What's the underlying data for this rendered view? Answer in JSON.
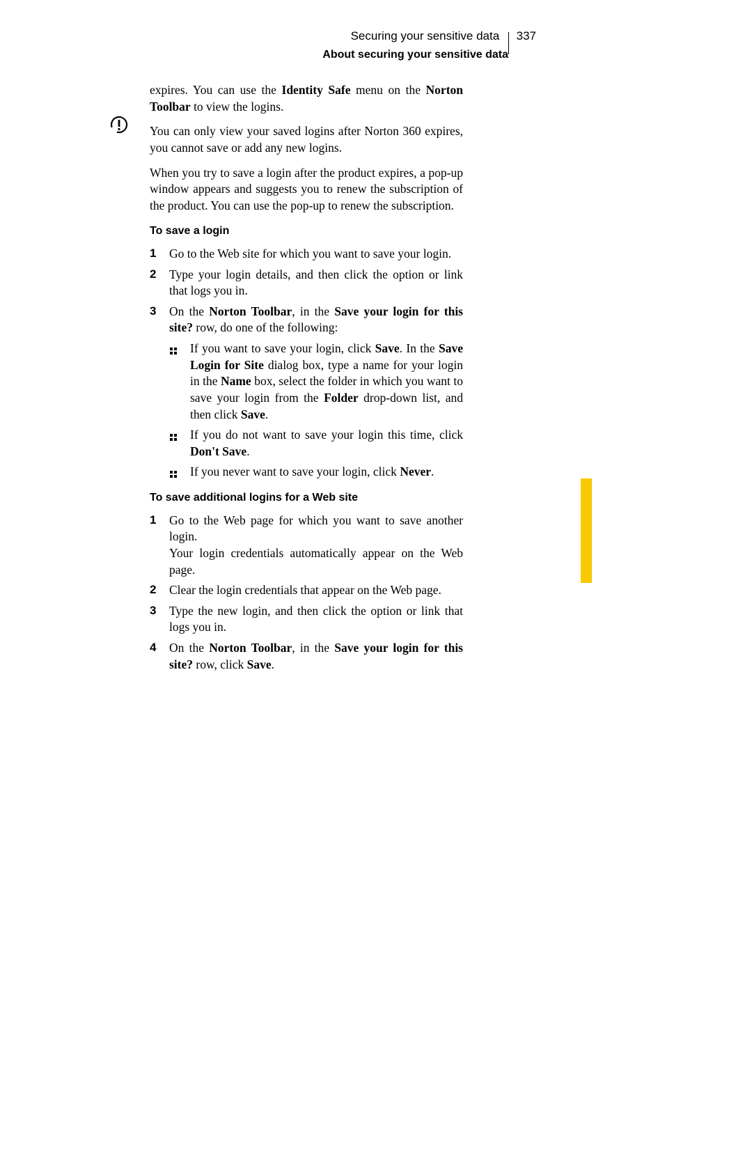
{
  "header": {
    "chapter": "Securing your sensitive data",
    "page_number": "337",
    "section": "About securing your sensitive data"
  },
  "body": {
    "p1_a": "expires. You can use the ",
    "p1_b": "Identity Safe",
    "p1_c": " menu on the ",
    "p1_d": "Norton Toolbar",
    "p1_e": " to view the logins.",
    "p2": "You can only view your saved logins after Norton 360 expires, you cannot save or add any new logins.",
    "p3": "When you try to save a login after the product expires, a pop-up window appears and suggests you to renew the subscription of the product. You can use the pop-up to renew the subscription.",
    "h1": "To save a login",
    "s1_1": "Go to the Web site for which you want to save your login.",
    "s1_2": "Type your login details, and then click the option or link that logs you in.",
    "s1_3a": "On the ",
    "s1_3b": "Norton Toolbar",
    "s1_3c": ", in the ",
    "s1_3d": "Save your login for this site?",
    "s1_3e": " row, do one of the following:",
    "s1_3_b1a": "If you want to save your login, click ",
    "s1_3_b1b": "Save",
    "s1_3_b1c": ". In the ",
    "s1_3_b1d": "Save Login for Site",
    "s1_3_b1e": " dialog box, type a name for your login in the ",
    "s1_3_b1f": "Name",
    "s1_3_b1g": " box, select the folder in which you want to save your login from the ",
    "s1_3_b1h": "Folder",
    "s1_3_b1i": " drop-down list, and then click ",
    "s1_3_b1j": "Save",
    "s1_3_b1k": ".",
    "s1_3_b2a": "If you do not want to save your login this time, click ",
    "s1_3_b2b": "Don't Save",
    "s1_3_b2c": ".",
    "s1_3_b3a": "If you never want to save your login, click ",
    "s1_3_b3b": "Never",
    "s1_3_b3c": ".",
    "h2": "To save additional logins for a Web site",
    "s2_1a": "Go to the Web page for which you want to save another login.",
    "s2_1b": "Your login credentials automatically appear on the Web page.",
    "s2_2": "Clear the login credentials that appear on the Web page.",
    "s2_3": "Type the new login, and then click the option or link that logs you in.",
    "s2_4a": "On the ",
    "s2_4b": "Norton Toolbar",
    "s2_4c": ", in the ",
    "s2_4d": "Save your login for this site?",
    "s2_4e": " row, click ",
    "s2_4f": "Save",
    "s2_4g": "."
  }
}
